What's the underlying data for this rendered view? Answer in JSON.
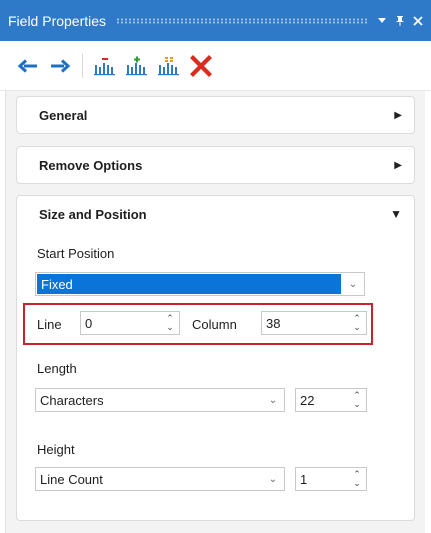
{
  "window": {
    "title": "Field Properties",
    "controls": [
      "dropdown-icon",
      "pin-icon",
      "close-icon"
    ]
  },
  "toolbar": {
    "buttons": [
      {
        "name": "back",
        "icon": "arrow-left-icon"
      },
      {
        "name": "forward",
        "icon": "arrow-right-icon"
      },
      {
        "name": "remove-field",
        "icon": "chart-minus-icon"
      },
      {
        "name": "add-field",
        "icon": "chart-plus-icon"
      },
      {
        "name": "auto-define",
        "icon": "chart-grid-icon"
      },
      {
        "name": "delete",
        "icon": "red-x-icon"
      }
    ]
  },
  "sections": {
    "general": {
      "title": "General",
      "expanded": false
    },
    "remove_options": {
      "title": "Remove Options",
      "expanded": false
    },
    "size_position": {
      "title": "Size and Position",
      "expanded": true,
      "start_position_label": "Start Position",
      "start_position_value": "Fixed",
      "line_label": "Line",
      "line_value": "0",
      "column_label": "Column",
      "column_value": "38",
      "length_label": "Length",
      "length_unit": "Characters",
      "length_value": "22",
      "height_label": "Height",
      "height_unit": "Line Count",
      "height_value": "1"
    }
  },
  "colors": {
    "titlebar": "#2f79c9",
    "accent_blue": "#0a74d8",
    "highlight_red": "#c8232c",
    "delete_red": "#d92b1e"
  }
}
